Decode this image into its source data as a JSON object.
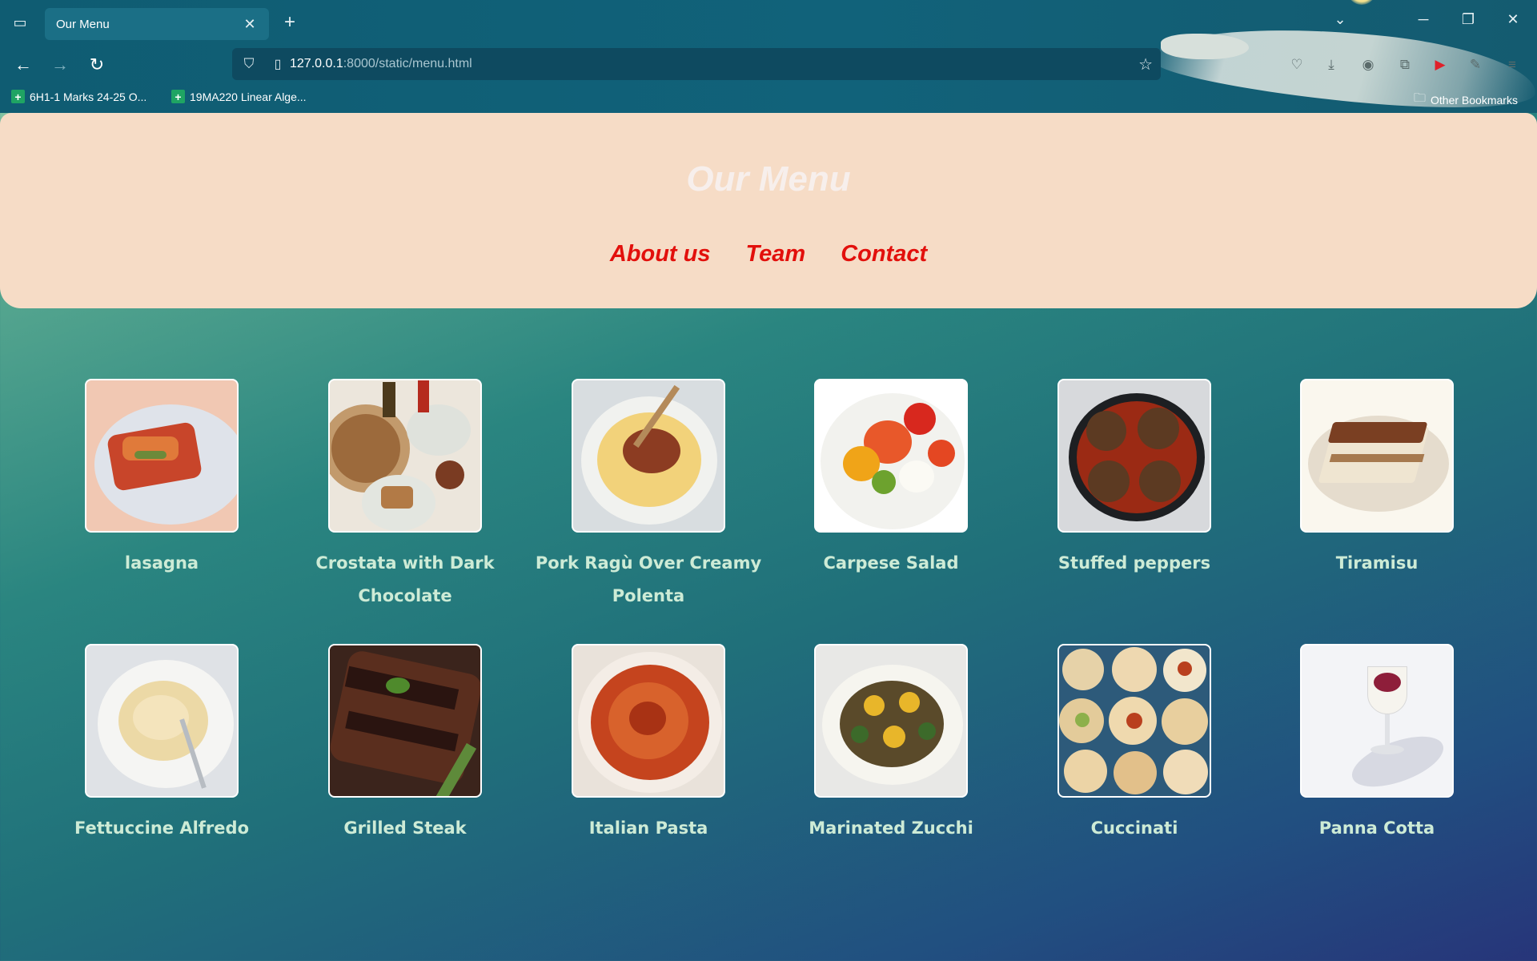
{
  "browser": {
    "tab": {
      "title": "Our Menu"
    },
    "url": {
      "host": "127.0.0.1",
      "path": ":8000/static/menu.html"
    },
    "bookmarks": [
      {
        "label": "6H1-1 Marks 24-25 O..."
      },
      {
        "label": "19MA220 Linear Alge..."
      }
    ],
    "other_bookmarks": "Other Bookmarks"
  },
  "header": {
    "title": "Our Menu",
    "nav": [
      "About us",
      "Team",
      "Contact"
    ],
    "nav_color": "#e2100c",
    "background": "#f6dcc6"
  },
  "menu": {
    "items": [
      {
        "name": "lasagna",
        "icon": "lasagna-photo"
      },
      {
        "name": "Crostata with Dark Chocolate",
        "icon": "crostata-photo"
      },
      {
        "name": "Pork Ragù Over Creamy Polenta",
        "icon": "polenta-photo"
      },
      {
        "name": "Carpese Salad",
        "icon": "salad-photo"
      },
      {
        "name": "Stuffed peppers",
        "icon": "peppers-photo"
      },
      {
        "name": "Tiramisu",
        "icon": "tiramisu-photo"
      },
      {
        "name": "Fettuccine Alfredo",
        "icon": "fettuccine-photo"
      },
      {
        "name": "Grilled Steak",
        "icon": "steak-photo"
      },
      {
        "name": "Italian Pasta",
        "icon": "pasta-photo"
      },
      {
        "name": "Marinated Zucchi",
        "icon": "zucchini-photo"
      },
      {
        "name": "Cuccinati",
        "icon": "cuccinati-photo"
      },
      {
        "name": "Panna Cotta",
        "icon": "panna-cotta-photo"
      }
    ],
    "label_color": "#cdebd6"
  }
}
